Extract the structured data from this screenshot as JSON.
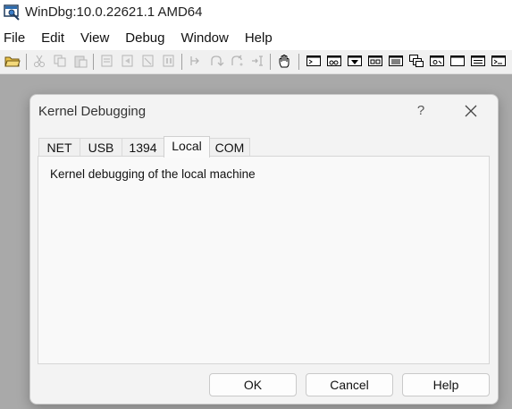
{
  "window": {
    "title": "WinDbg:10.0.22621.1 AMD64",
    "app_icon": "windbg-app-icon"
  },
  "menu": {
    "items": [
      "File",
      "Edit",
      "View",
      "Debug",
      "Window",
      "Help"
    ]
  },
  "toolbar": {
    "buttons": [
      {
        "icon": "open-folder-icon",
        "enabled": true
      },
      {
        "icon": "cut-icon",
        "enabled": false
      },
      {
        "icon": "copy-icon",
        "enabled": false
      },
      {
        "icon": "paste-icon",
        "enabled": false
      },
      {
        "icon": "go-icon",
        "enabled": false
      },
      {
        "icon": "restart-icon",
        "enabled": false
      },
      {
        "icon": "stop-debugging-icon",
        "enabled": false
      },
      {
        "icon": "break-icon",
        "enabled": false
      },
      {
        "icon": "step-into-icon",
        "enabled": false
      },
      {
        "icon": "step-over-icon",
        "enabled": false
      },
      {
        "icon": "step-out-icon",
        "enabled": false
      },
      {
        "icon": "run-to-cursor-icon",
        "enabled": false
      },
      {
        "icon": "hand-icon",
        "enabled": true
      },
      {
        "icon": "command-window-icon",
        "enabled": true
      },
      {
        "icon": "watch-window-icon",
        "enabled": true
      },
      {
        "icon": "locals-window-icon",
        "enabled": true
      },
      {
        "icon": "registers-window-icon",
        "enabled": true
      },
      {
        "icon": "memory-window-icon",
        "enabled": true
      },
      {
        "icon": "call-stack-window-icon",
        "enabled": true
      },
      {
        "icon": "disassembly-window-icon",
        "enabled": true
      },
      {
        "icon": "scratch-pad-icon",
        "enabled": true
      },
      {
        "icon": "processes-threads-icon",
        "enabled": true
      },
      {
        "icon": "command-browser-icon",
        "enabled": true
      }
    ]
  },
  "dialog": {
    "title": "Kernel Debugging",
    "help_glyph": "?",
    "tabs": [
      "NET",
      "USB",
      "1394",
      "Local",
      "COM"
    ],
    "active_tab": "Local",
    "panel_text": "Kernel debugging of the local machine",
    "buttons": {
      "ok": "OK",
      "cancel": "Cancel",
      "help": "Help"
    }
  },
  "colors": {
    "workspace": "#a9a9a9",
    "dialog_bg": "#f3f3f3",
    "toolbar_bg": "#f0f0f0"
  }
}
